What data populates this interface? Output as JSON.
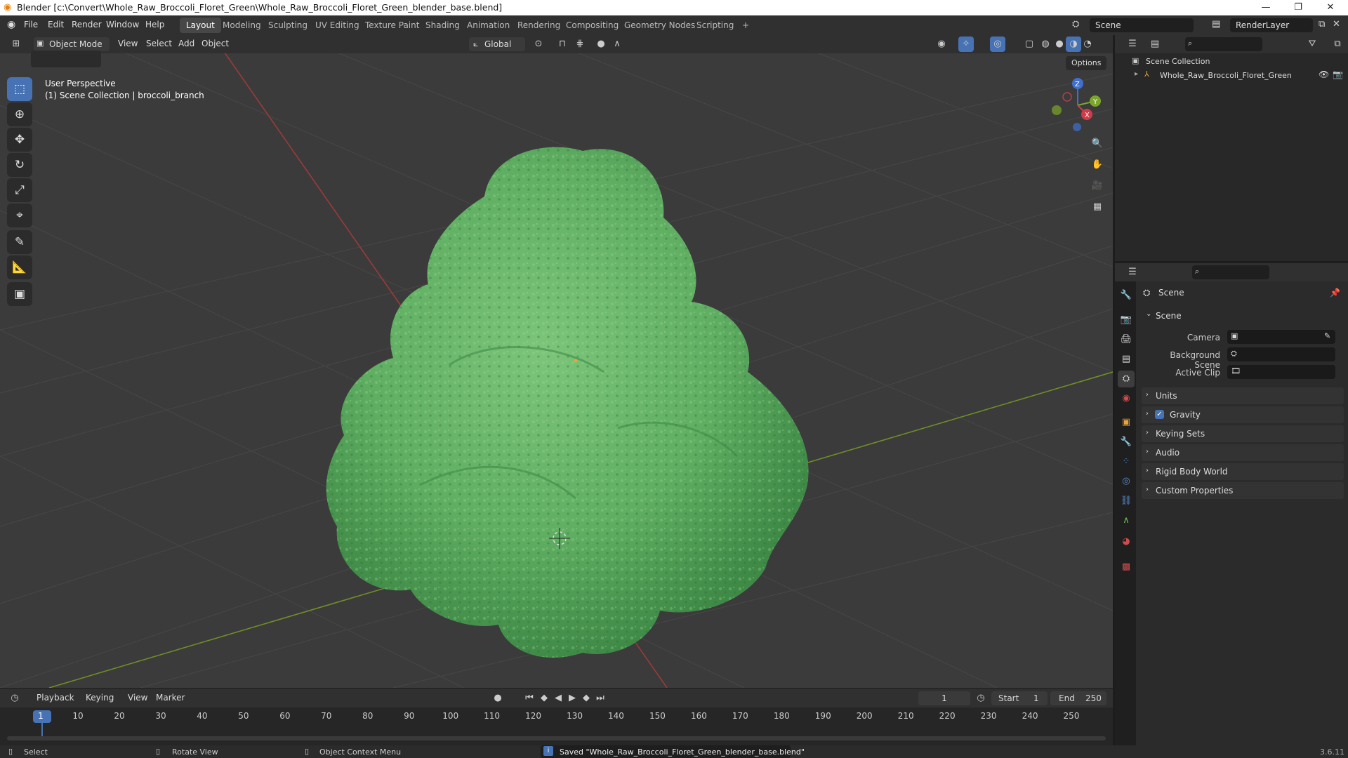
{
  "window": {
    "title": "Blender [c:\\Convert\\Whole_Raw_Broccoli_Floret_Green\\Whole_Raw_Broccoli_Floret_Green_blender_base.blend]",
    "minimize": "—",
    "maximize": "❐",
    "close": "✕"
  },
  "menus": [
    "File",
    "Edit",
    "Render",
    "Window",
    "Help"
  ],
  "workspaces": [
    "Layout",
    "Modeling",
    "Sculpting",
    "UV Editing",
    "Texture Paint",
    "Shading",
    "Animation",
    "Rendering",
    "Compositing",
    "Geometry Nodes",
    "Scripting"
  ],
  "workspace_add": "+",
  "scene_name": "Scene",
  "view_layer": "RenderLayer",
  "viewport": {
    "mode": "Object Mode",
    "menus": [
      "View",
      "Select",
      "Add",
      "Object"
    ],
    "orientation": "Global",
    "options": "Options",
    "overlay_line1": "User Perspective",
    "overlay_line2": "(1) Scene Collection | broccoli_branch",
    "gizmo": {
      "x": "X",
      "y": "Y",
      "z": "Z"
    }
  },
  "outliner": {
    "root": "Scene Collection",
    "item": "Whole_Raw_Broccoli_Floret_Green"
  },
  "properties": {
    "title": "Scene",
    "section": "Scene",
    "camera_label": "Camera",
    "bg_label": "Background Scene",
    "clip_label": "Active Clip",
    "panels": [
      "Units",
      "Gravity",
      "Keying Sets",
      "Audio",
      "Rigid Body World",
      "Custom Properties"
    ],
    "gravity_checked": true
  },
  "timeline": {
    "menus": [
      "Playback",
      "Keying",
      "View",
      "Marker"
    ],
    "current_frame": "1",
    "start_label": "Start",
    "start": "1",
    "end_label": "End",
    "end": "250",
    "ticks": [
      "1",
      "10",
      "20",
      "30",
      "40",
      "50",
      "60",
      "70",
      "80",
      "90",
      "100",
      "110",
      "120",
      "130",
      "140",
      "150",
      "160",
      "170",
      "180",
      "190",
      "200",
      "210",
      "220",
      "230",
      "240",
      "250"
    ]
  },
  "status": {
    "select": "Select",
    "rotate": "Rotate View",
    "context": "Object Context Menu",
    "message": "Saved \"Whole_Raw_Broccoli_Floret_Green_blender_base.blend\"",
    "version": "3.6.11"
  },
  "colors": {
    "accent": "#4772b3",
    "object": "#5fae62",
    "header": "#303030",
    "viewport_bg": "#3b3b3b"
  }
}
